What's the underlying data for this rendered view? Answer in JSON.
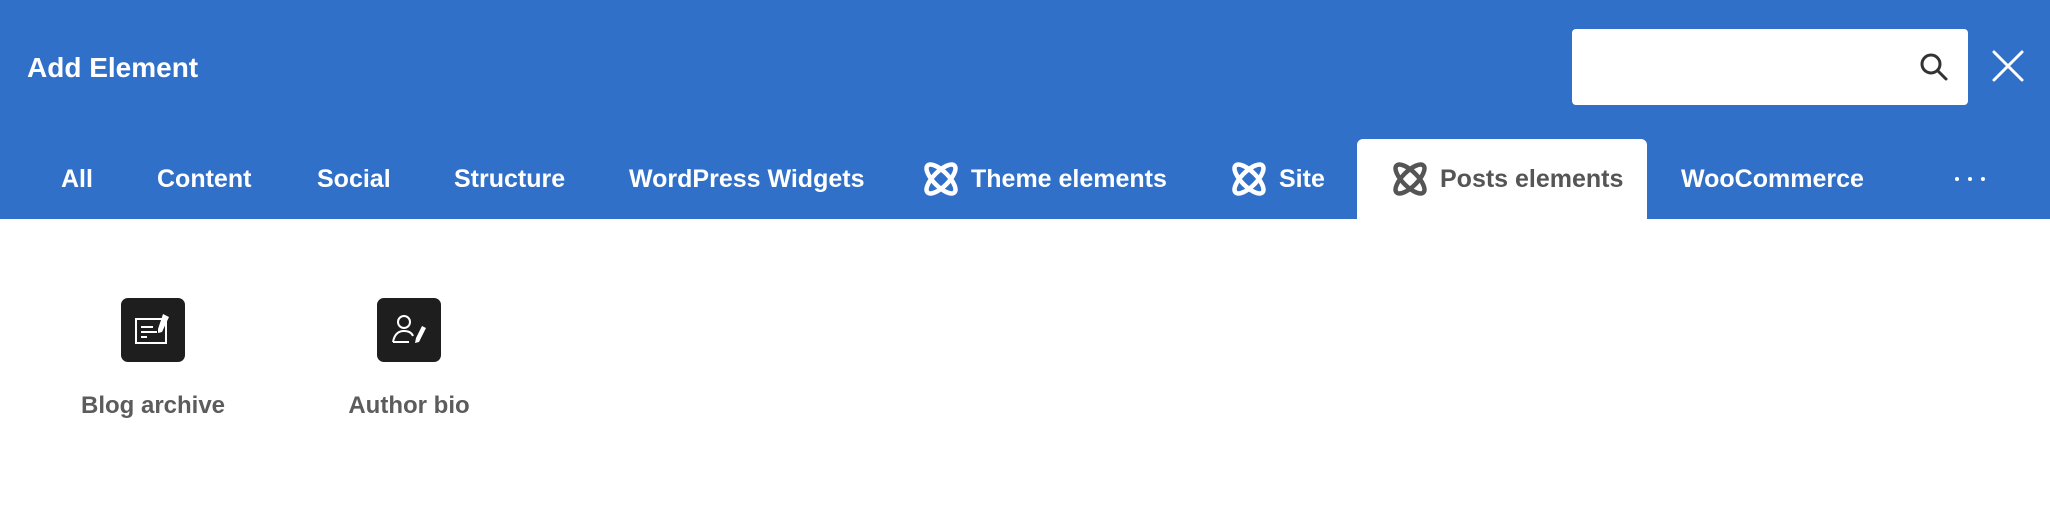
{
  "header": {
    "title": "Add Element",
    "search": {
      "value": "",
      "placeholder": ""
    },
    "search_icon": "search-icon",
    "close_icon": "close-icon"
  },
  "colors": {
    "header_bg": "#3170c8",
    "active_tab_text": "#555555",
    "item_icon_bg": "#1e1e1e",
    "item_label": "#5c5c5c"
  },
  "tabs": [
    {
      "label": "All",
      "icon": null
    },
    {
      "label": "Content",
      "icon": null
    },
    {
      "label": "Social",
      "icon": null
    },
    {
      "label": "Structure",
      "icon": null
    },
    {
      "label": "WordPress Widgets",
      "icon": null
    },
    {
      "label": "Theme elements",
      "icon": "atom-icon"
    },
    {
      "label": "Site",
      "icon": "atom-icon"
    },
    {
      "label": "Posts elements",
      "icon": "atom-icon",
      "active": true
    },
    {
      "label": "WooCommerce",
      "icon": null
    }
  ],
  "more_icon": "more-dots-icon",
  "elements": [
    {
      "label": "Blog archive",
      "icon": "blog-archive-icon"
    },
    {
      "label": "Author bio",
      "icon": "author-bio-icon"
    }
  ]
}
